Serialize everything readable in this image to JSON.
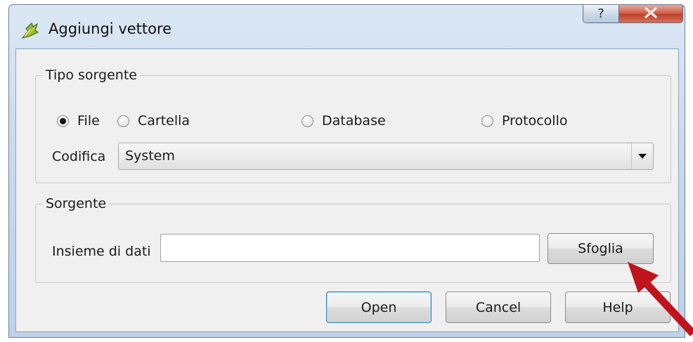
{
  "window": {
    "title": "Aggiungi vettore",
    "app_icon": "qgis-icon",
    "help_button_label": "?",
    "close_button_icon": "close-icon"
  },
  "source_type": {
    "group_title": "Tipo sorgente",
    "options": [
      {
        "label": "File",
        "selected": true
      },
      {
        "label": "Cartella",
        "selected": false
      },
      {
        "label": "Database",
        "selected": false
      },
      {
        "label": "Protocollo",
        "selected": false
      }
    ],
    "encoding_label": "Codifica",
    "encoding_value": "System"
  },
  "source": {
    "group_title": "Sorgente",
    "dataset_label": "Insieme di dati",
    "dataset_value": "",
    "dataset_placeholder": "",
    "browse_label": "Sfoglia"
  },
  "buttons": {
    "open": "Open",
    "cancel": "Cancel",
    "help": "Help"
  },
  "annotation": {
    "arrow_color": "#c0141c",
    "points_to": "Sfoglia"
  },
  "colors": {
    "close_button": "#c7432c",
    "dialog_background": "#f0f0f0",
    "frame": "#c8d9ec"
  }
}
